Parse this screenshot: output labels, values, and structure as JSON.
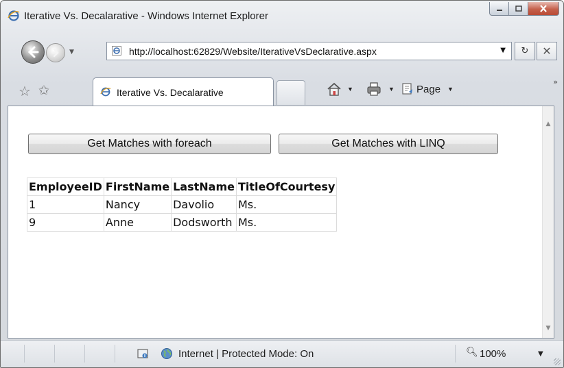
{
  "window": {
    "title": "Iterative Vs. Decalarative - Windows Internet Explorer"
  },
  "address": {
    "url": "http://localhost:62829/Website/IterativeVsDeclarative.aspx"
  },
  "tab": {
    "label": "Iterative Vs. Decalarative"
  },
  "command_bar": {
    "page_label": "Page"
  },
  "buttons": {
    "foreach_label": "Get Matches with foreach",
    "linq_label": "Get Matches with LINQ"
  },
  "grid": {
    "headers": [
      "EmployeeID",
      "FirstName",
      "LastName",
      "TitleOfCourtesy"
    ],
    "rows": [
      [
        "1",
        "Nancy",
        "Davolio",
        "Ms."
      ],
      [
        "9",
        "Anne",
        "Dodsworth",
        "Ms."
      ]
    ]
  },
  "status": {
    "zone_text": "Internet | Protected Mode: On",
    "zoom": "100%"
  },
  "icons": {
    "ie_logo": "ie-logo-icon",
    "home": "home-icon",
    "print": "print-icon",
    "page": "page-icon",
    "favorites": "star-icon",
    "globe": "globe-icon",
    "zoom": "magnifier-icon"
  }
}
